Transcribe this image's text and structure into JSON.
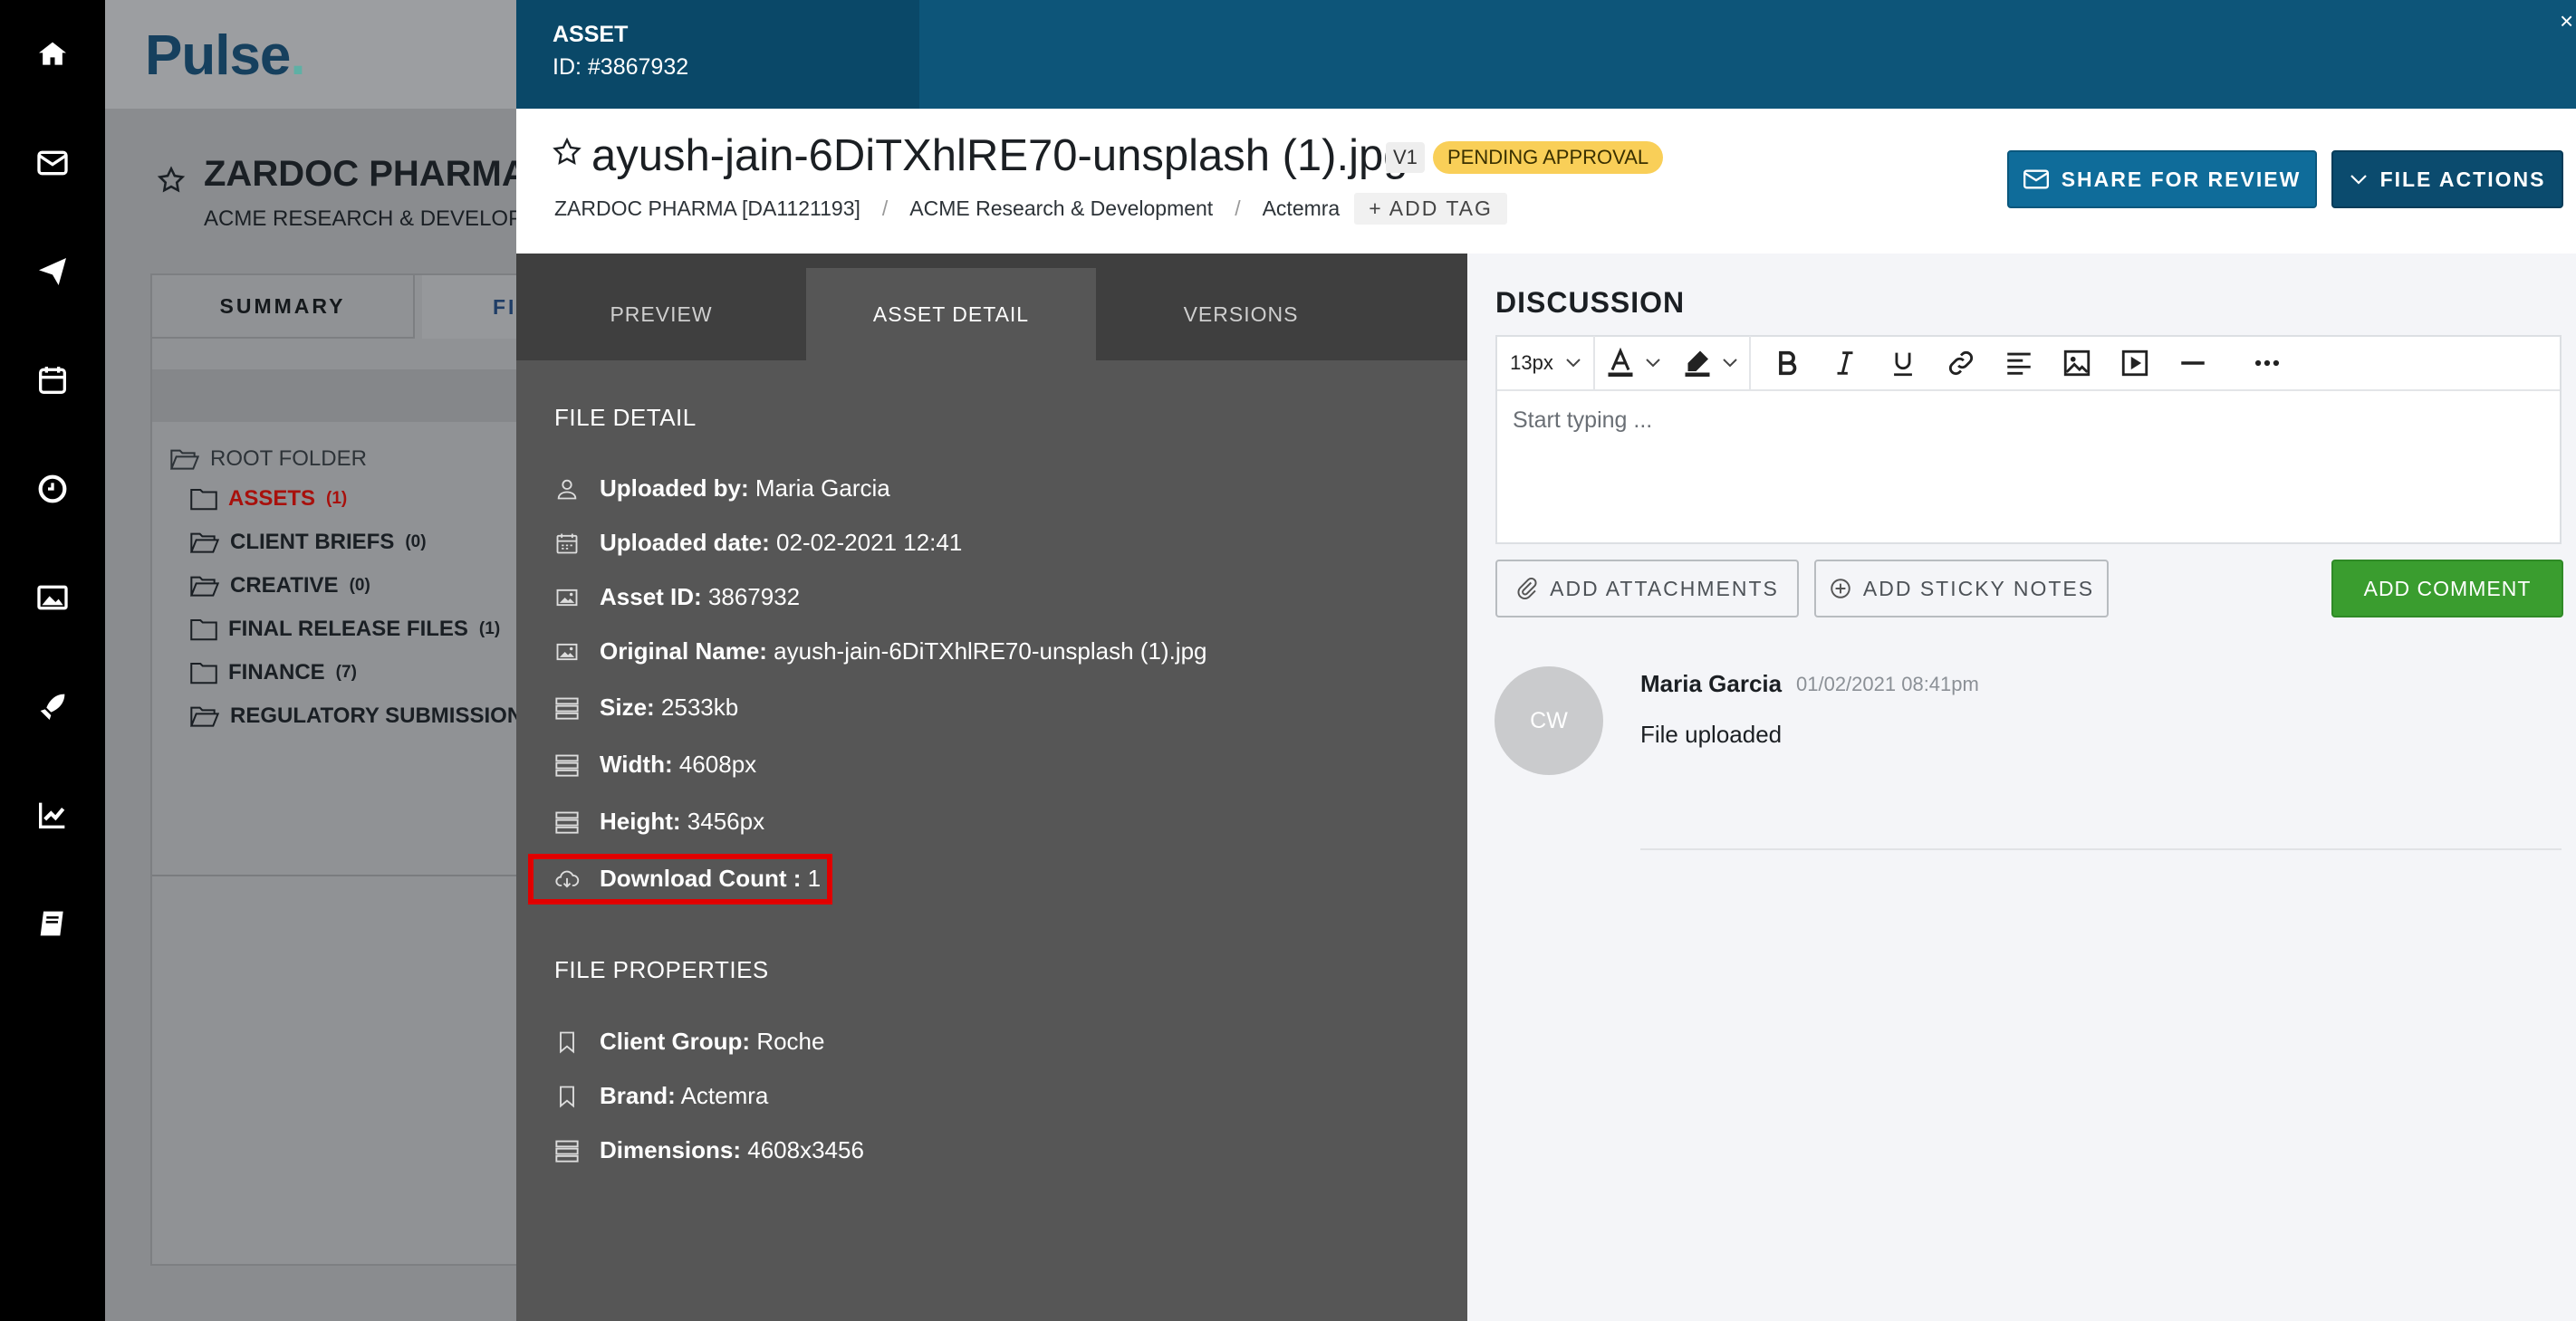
{
  "rail": {
    "icons": [
      "home-icon",
      "mail-icon",
      "send-icon",
      "calendar-icon",
      "clock-icon",
      "image-icon",
      "rocket-icon",
      "chart-icon",
      "book-icon"
    ]
  },
  "background": {
    "logo": "Pulse",
    "logo_dot": ".",
    "project_title": "ZARDOC PHARMA",
    "project_subtitle": "ACME RESEARCH & DEVELOPM",
    "tabs": {
      "summary": "SUMMARY",
      "files": "FI"
    },
    "folders": [
      {
        "name": "ROOT FOLDER",
        "count": ""
      },
      {
        "name": "ASSETS",
        "count": "(1)"
      },
      {
        "name": "CLIENT BRIEFS",
        "count": "(0)"
      },
      {
        "name": "CREATIVE",
        "count": "(0)"
      },
      {
        "name": "FINAL RELEASE FILES",
        "count": "(1)"
      },
      {
        "name": "FINANCE",
        "count": "(7)"
      },
      {
        "name": "REGULATORY SUBMISSIONS",
        "count": ""
      }
    ]
  },
  "modal": {
    "header": {
      "label": "ASSET",
      "id_text": "ID: #3867932",
      "close": "×"
    },
    "title": "ayush-jain-6DiTXhlRE70-unsplash (1).jpg",
    "version": "V1",
    "status": "PENDING APPROVAL",
    "breadcrumb": [
      "ZARDOC PHARMA [DA1121193]",
      "ACME Research & Development",
      "Actemra"
    ],
    "breadcrumb_sep": "/",
    "add_tag": "+ ADD TAG",
    "share_button": "SHARE FOR REVIEW",
    "actions_button": "FILE ACTIONS",
    "tabs": {
      "preview": "PREVIEW",
      "asset_detail": "ASSET DETAIL",
      "versions": "VERSIONS"
    },
    "file_detail": {
      "heading": "FILE DETAIL",
      "rows": [
        {
          "label": "Uploaded by:",
          "value": " Maria Garcia"
        },
        {
          "label": "Uploaded date:",
          "value": " 02-02-2021 12:41"
        },
        {
          "label": "Asset ID:",
          "value": " 3867932"
        },
        {
          "label": "Original Name:",
          "value": " ayush-jain-6DiTXhlRE70-unsplash (1).jpg"
        },
        {
          "label": "Size:",
          "value": " 2533kb"
        },
        {
          "label": "Width:",
          "value": " 4608px"
        },
        {
          "label": "Height:",
          "value": " 3456px"
        },
        {
          "label": "Download Count :",
          "value": " 1"
        }
      ]
    },
    "file_properties": {
      "heading": "FILE PROPERTIES",
      "rows": [
        {
          "label": "Client Group:",
          "value": " Roche"
        },
        {
          "label": "Brand:",
          "value": " Actemra"
        },
        {
          "label": "Dimensions:",
          "value": " 4608x3456"
        }
      ]
    },
    "discussion": {
      "heading": "DISCUSSION",
      "font_size": "13px",
      "placeholder": "Start typing ...",
      "attach_button": "ADD ATTACHMENTS",
      "sticky_button": "ADD STICKY NOTES",
      "comment_button": "ADD COMMENT",
      "comment": {
        "avatar": "CW",
        "author": "Maria Garcia",
        "time": "01/02/2021 08:41pm",
        "text": "File uploaded"
      }
    }
  },
  "colors": {
    "header_blue": "#0d5579",
    "primary_button": "#0f6c9a",
    "pending_badge": "#f9cf58",
    "comment_button": "#3a9d2f",
    "highlight_red": "#e10000",
    "assets_folder_red": "#a8100c"
  }
}
